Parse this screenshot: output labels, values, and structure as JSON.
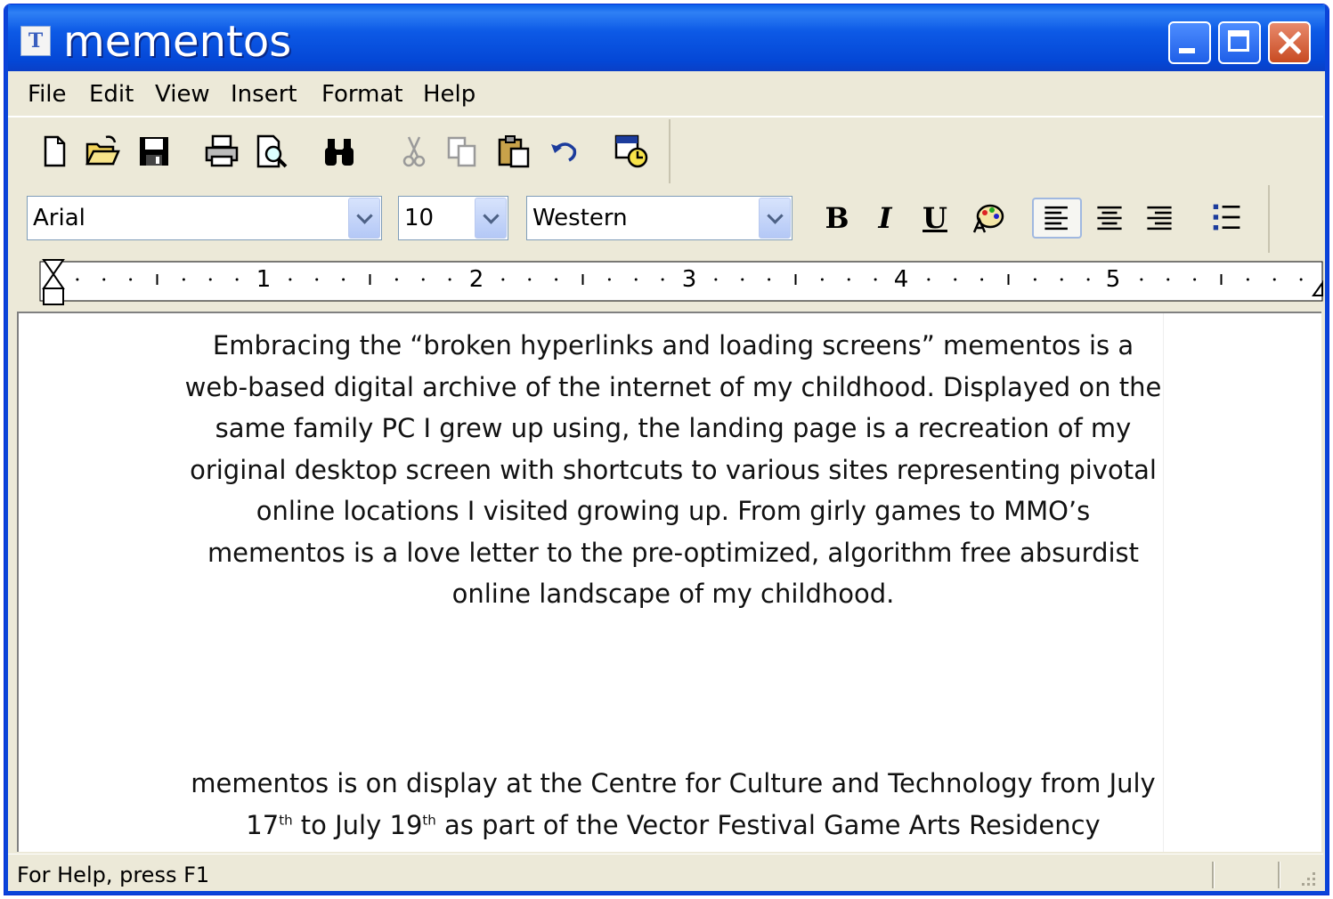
{
  "window": {
    "title": "mementos",
    "app_icon_glyph": "T",
    "controls": [
      "minimize-icon",
      "maximize-icon",
      "close-icon"
    ]
  },
  "menu": {
    "items": [
      "File",
      "Edit",
      "View",
      "Insert",
      "Format",
      "Help"
    ]
  },
  "toolbar": {
    "icons": [
      "new-document-icon",
      "open-folder-icon",
      "save-icon",
      "print-icon",
      "print-preview-icon",
      "find-binoculars-icon",
      "cut-icon",
      "copy-icon",
      "paste-icon",
      "undo-icon",
      "date-time-icon"
    ]
  },
  "format_bar": {
    "font": "Arial",
    "size": "10",
    "script": "Western",
    "bold_label": "B",
    "italic_label": "I",
    "underline_label": "U",
    "icons": [
      "bold-icon",
      "italic-icon",
      "underline-icon",
      "color-palette-icon",
      "align-left-icon",
      "align-center-icon",
      "align-right-icon",
      "bullets-icon"
    ],
    "active_alignment": "left"
  },
  "ruler": {
    "labels": [
      "1",
      "2",
      "3",
      "4",
      "5"
    ]
  },
  "document": {
    "paragraph1": "Embracing the “broken hyperlinks and loading screens” mementos is a web-based digital archive of the internet of my childhood. Displayed on the same family PC I grew up using, the landing page is a recreation of my original desktop screen with shortcuts to various sites representing pivotal online locations I visited growing up. From girly games to MMO’s mementos is a love letter to the pre-optimized, algorithm free absurdist online landscape of my childhood.",
    "paragraph2_part1": "mementos is on display at the Centre for Culture and Technology from July 17",
    "paragraph2_sup1": "th",
    "paragraph2_part2": " to July 19",
    "paragraph2_sup2": "th",
    "paragraph2_part3": " as part of the Vector Festival Game Arts Residency"
  },
  "status": {
    "text": "For Help, press F1"
  },
  "colors": {
    "titlebar": "#0a5fe8",
    "chrome": "#ece9d8",
    "close": "#c84b22"
  }
}
